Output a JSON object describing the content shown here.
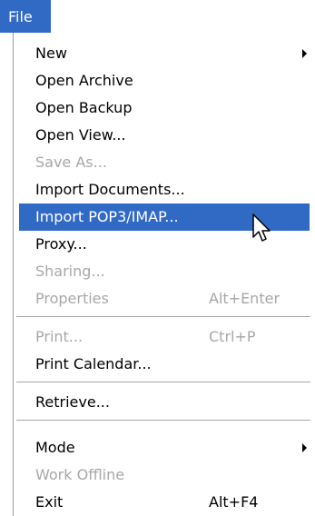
{
  "menubar": {
    "file_label": "File"
  },
  "menu": {
    "items": [
      {
        "label": "New",
        "shortcut": "",
        "submenu": true,
        "disabled": false
      },
      {
        "label": "Open Archive",
        "shortcut": "",
        "submenu": false,
        "disabled": false
      },
      {
        "label": "Open Backup",
        "shortcut": "",
        "submenu": false,
        "disabled": false
      },
      {
        "label": "Open View...",
        "shortcut": "",
        "submenu": false,
        "disabled": false
      },
      {
        "label": "Save As...",
        "shortcut": "",
        "submenu": false,
        "disabled": true
      },
      {
        "label": "Import Documents...",
        "shortcut": "",
        "submenu": false,
        "disabled": false
      },
      {
        "label": "Import POP3/IMAP...",
        "shortcut": "",
        "submenu": false,
        "disabled": false,
        "highlighted": true
      },
      {
        "label": "Proxy...",
        "shortcut": "",
        "submenu": false,
        "disabled": false
      },
      {
        "label": "Sharing...",
        "shortcut": "",
        "submenu": false,
        "disabled": true
      },
      {
        "label": "Properties",
        "shortcut": "Alt+Enter",
        "submenu": false,
        "disabled": true
      },
      {
        "label": "Print...",
        "shortcut": "Ctrl+P",
        "submenu": false,
        "disabled": true
      },
      {
        "label": "Print Calendar...",
        "shortcut": "",
        "submenu": false,
        "disabled": false
      },
      {
        "label": "Retrieve...",
        "shortcut": "",
        "submenu": false,
        "disabled": false
      },
      {
        "label": "Mode",
        "shortcut": "",
        "submenu": true,
        "disabled": false
      },
      {
        "label": "Work Offline",
        "shortcut": "",
        "submenu": false,
        "disabled": true
      },
      {
        "label": "Exit",
        "shortcut": "Alt+F4",
        "submenu": false,
        "disabled": false
      }
    ]
  },
  "colors": {
    "highlight": "#316ac5",
    "disabled_text": "#a7a6aa",
    "separator": "#a7a6aa"
  },
  "cursor": {
    "icon": "arrow-pointer-icon"
  }
}
